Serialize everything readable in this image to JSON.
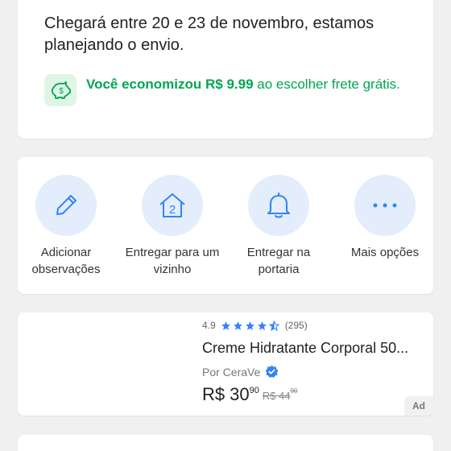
{
  "delivery": {
    "message": "Chegará entre 20 e 23 de novembro, estamos planejando o envio.",
    "savings_bold": "Você economizou R$ 9.99",
    "savings_rest": " ao escolher frete grátis."
  },
  "actions": [
    {
      "label": "Adicionar observações",
      "icon": "pencil-icon"
    },
    {
      "label": "Entregar para um vizinho",
      "icon": "house-icon"
    },
    {
      "label": "Entregar na portaria",
      "icon": "bell-icon"
    },
    {
      "label": "Mais opções",
      "icon": "more-icon"
    }
  ],
  "product": {
    "rating": "4.9",
    "rating_value": 4.9,
    "reviews": "(295)",
    "title": "Creme Hidratante Corporal 50...",
    "seller": "Por CeraVe",
    "currency": "R$",
    "price_int": "30",
    "price_cents": "90",
    "old_price": "R$ 44",
    "old_cents": "90",
    "ad_label": "Ad"
  },
  "colors": {
    "accent_blue": "#3483fa",
    "savings_green": "#00a650",
    "icon_circle_bg": "#e3edfb"
  }
}
